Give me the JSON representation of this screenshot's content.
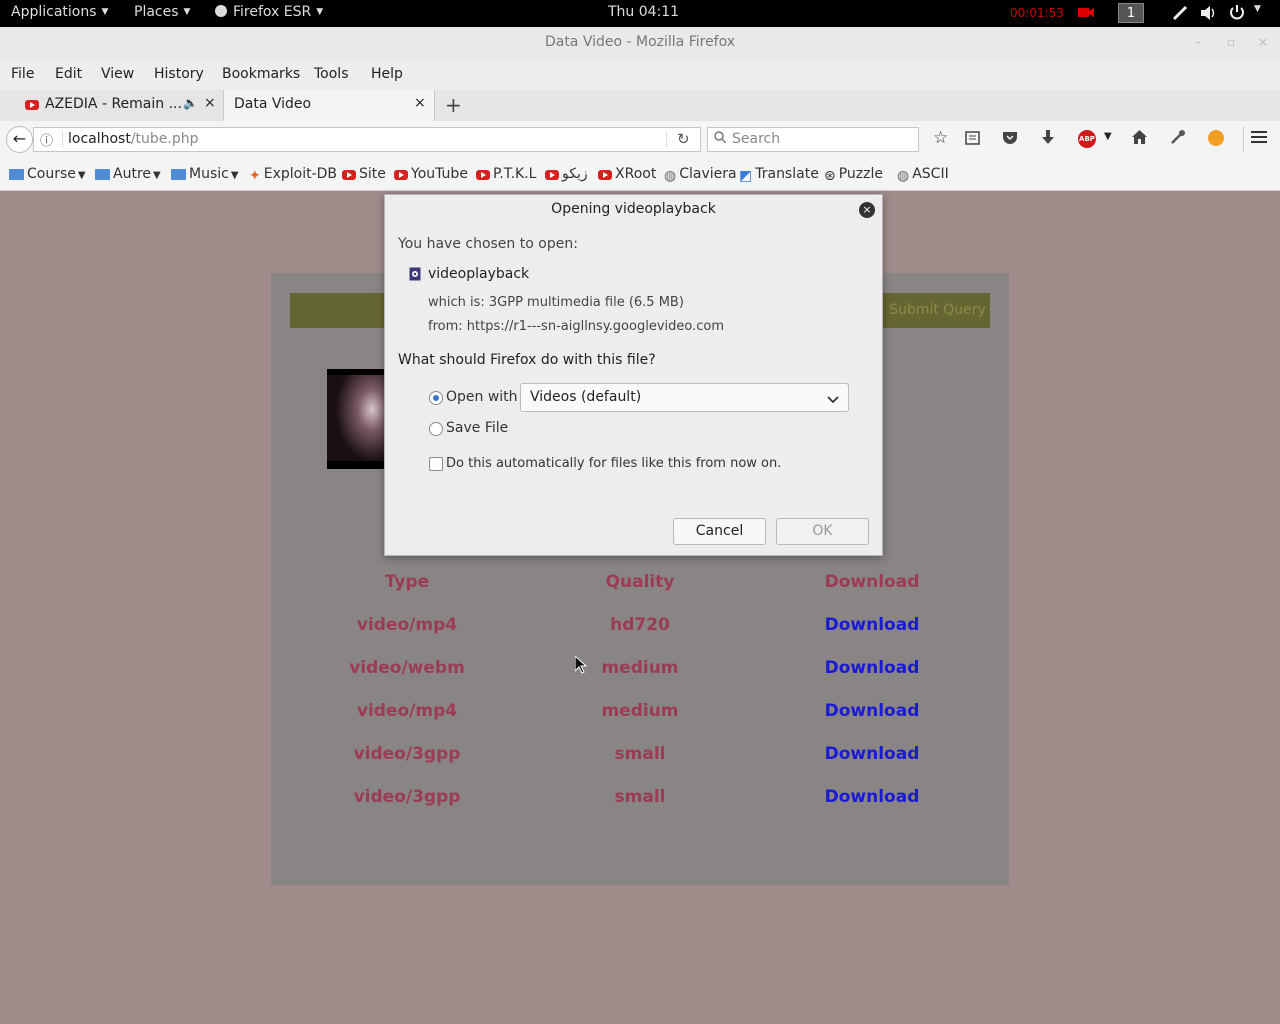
{
  "topbar": {
    "applications": "Applications",
    "places": "Places",
    "firefox": "Firefox ESR",
    "clock": "Thu 04:11",
    "recorder": "00:01:53",
    "workspace": "1"
  },
  "window": {
    "title": "Data Video - Mozilla Firefox"
  },
  "menu": [
    "File",
    "Edit",
    "View",
    "History",
    "Bookmarks",
    "Tools",
    "Help"
  ],
  "tabs": [
    {
      "label": "AZEDIA - Remain ...",
      "icon": "youtube-icon"
    },
    {
      "label": "Data Video",
      "icon": ""
    }
  ],
  "nav": {
    "url_host": "localhost",
    "url_path": "/tube.php",
    "search_placeholder": "Search"
  },
  "bookmarks": [
    {
      "label": "Course",
      "icon": "folder-icon",
      "dropdown": true
    },
    {
      "label": "Autre",
      "icon": "folder-icon",
      "dropdown": true
    },
    {
      "label": "Music",
      "icon": "folder-icon",
      "dropdown": true
    },
    {
      "label": "Exploit-DB",
      "icon": "exploitdb-icon",
      "dropdown": false
    },
    {
      "label": "Site",
      "icon": "youtube-icon",
      "dropdown": false
    },
    {
      "label": "YouTube",
      "icon": "youtube-icon",
      "dropdown": false
    },
    {
      "label": "P.T.K.L",
      "icon": "youtube-icon",
      "dropdown": false
    },
    {
      "label": "زيكو",
      "icon": "youtube-icon",
      "dropdown": false
    },
    {
      "label": "XRoot",
      "icon": "youtube-icon",
      "dropdown": false
    },
    {
      "label": "Claviera",
      "icon": "globe-icon",
      "dropdown": false
    },
    {
      "label": "Translate",
      "icon": "translate-icon",
      "dropdown": false
    },
    {
      "label": "Puzzle",
      "icon": "puzzle-icon",
      "dropdown": false
    },
    {
      "label": "ASCII",
      "icon": "globe-icon",
      "dropdown": false
    }
  ],
  "page": {
    "submit_label": "Submit Query",
    "headers": [
      "Type",
      "Quality",
      "Download"
    ],
    "rows": [
      {
        "type": "video/mp4",
        "quality": "hd720",
        "link": "Download"
      },
      {
        "type": "video/webm",
        "quality": "medium",
        "link": "Download"
      },
      {
        "type": "video/mp4",
        "quality": "medium",
        "link": "Download"
      },
      {
        "type": "video/3gpp",
        "quality": "small",
        "link": "Download"
      },
      {
        "type": "video/3gpp",
        "quality": "small",
        "link": "Download"
      }
    ]
  },
  "dialog": {
    "title": "Opening videoplayback",
    "intro": "You have chosen to open:",
    "filename": "videoplayback",
    "which_is": "which is:  3GPP multimedia file (6.5 MB)",
    "from": "from:  https://r1---sn-aigllnsy.googlevideo.com",
    "question": "What should Firefox do with this file?",
    "open_with_label": "Open with",
    "open_with_value": "Videos (default)",
    "save_label": "Save File",
    "auto_label": "Do this automatically for files like this from now on.",
    "cancel": "Cancel",
    "ok": "OK",
    "selected_option": "open_with"
  },
  "colors": {
    "page_bg": "#a08a8a",
    "header_text": "#9b3b55",
    "link": "#1a1ad6",
    "radio_accent": "#3b74d1"
  }
}
